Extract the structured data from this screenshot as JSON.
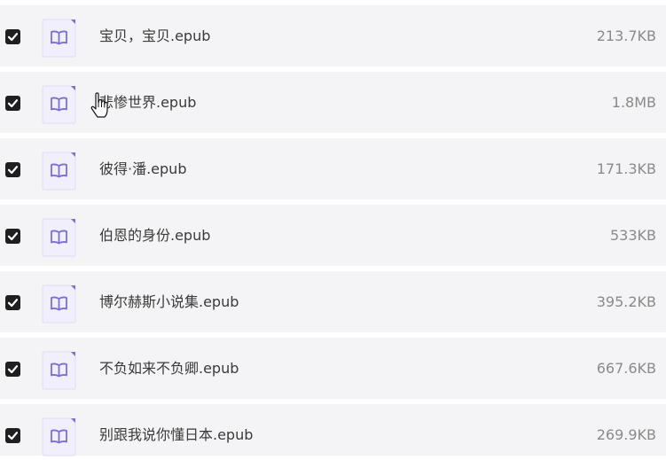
{
  "colors": {
    "row_background": "#f4f4f6",
    "checkbox_fill": "#1f1f1f",
    "icon_accent": "#7b6fd6",
    "icon_body": "#f0effb",
    "name_text": "#3a3a3a",
    "size_text": "#8a8a8a"
  },
  "files": [
    {
      "name": "宝贝，宝贝.epub",
      "size": "213.7KB",
      "checked": true,
      "icon": "book-file-icon"
    },
    {
      "name": "悲惨世界.epub",
      "size": "1.8MB",
      "checked": true,
      "icon": "book-file-icon"
    },
    {
      "name": "彼得·潘.epub",
      "size": "171.3KB",
      "checked": true,
      "icon": "book-file-icon"
    },
    {
      "name": "伯恩的身份.epub",
      "size": "533KB",
      "checked": true,
      "icon": "book-file-icon"
    },
    {
      "name": "博尔赫斯小说集.epub",
      "size": "395.2KB",
      "checked": true,
      "icon": "book-file-icon"
    },
    {
      "name": "不负如来不负卿.epub",
      "size": "667.6KB",
      "checked": true,
      "icon": "book-file-icon"
    },
    {
      "name": "别跟我说你懂日本.epub",
      "size": "269.9KB",
      "checked": true,
      "icon": "book-file-icon"
    }
  ],
  "cursor": {
    "icon": "hand-pointer-icon"
  }
}
